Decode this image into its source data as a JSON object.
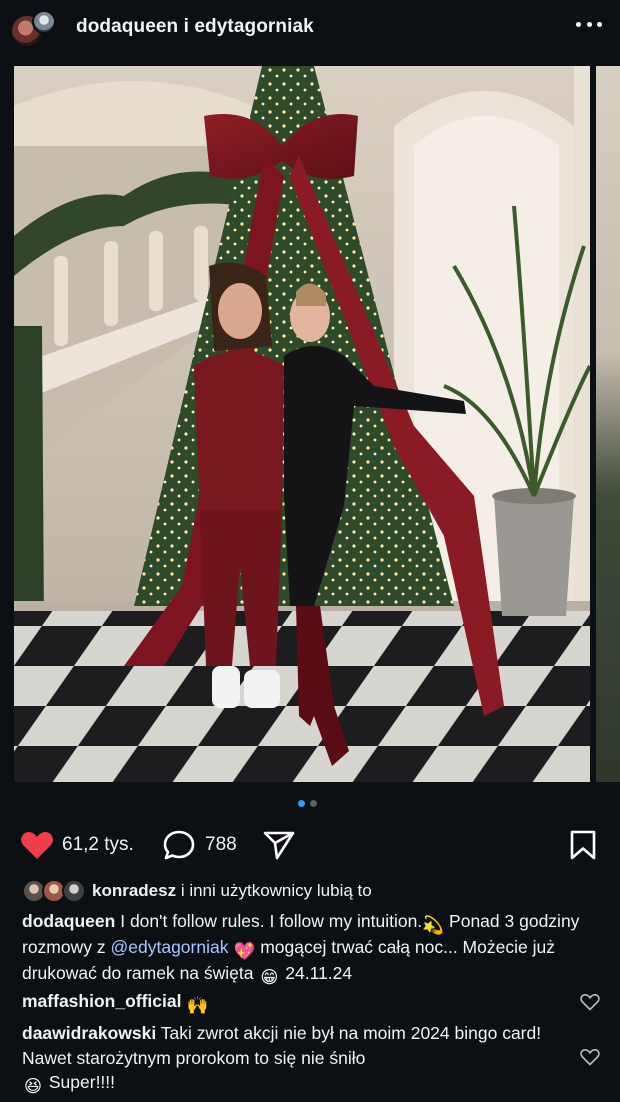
{
  "header": {
    "usernames": "dodaqueen i edytagorniak",
    "more_icon": "more-horizontal-icon"
  },
  "post": {
    "image_description_icon": "photo",
    "carousel": {
      "total": 2,
      "active_index": 0
    },
    "user_tag_icon": "person-icon"
  },
  "actions": {
    "likes": "61,2 tys.",
    "comments": "788",
    "like_color": "#ed3e49"
  },
  "liked_by": {
    "user": "konradesz",
    "rest": "i inni użytkownicy lubią to"
  },
  "caption": {
    "user": "dodaqueen",
    "text1": "I don't follow rules. I follow my intuition.",
    "emoji1": "💫",
    "text2": "Ponad 3 godziny rozmowy  z",
    "mention": "@edytagorniak",
    "emoji2": "💖",
    "text3": "mogącej trwać całą noc... Możecie już drukować do ramek na święta",
    "emoji3": "😁",
    "date": "24.11.24"
  },
  "comments": [
    {
      "user": "maffashion_official",
      "emoji": "🙌",
      "text": ""
    },
    {
      "user": "daawidrakowski",
      "text": "Taki zwrot akcji nie był na moim 2024 bingo card! Nawet starożytnym prorokom to się nie śniło",
      "emoji": "😆",
      "text_end": "Super!!!!"
    }
  ]
}
